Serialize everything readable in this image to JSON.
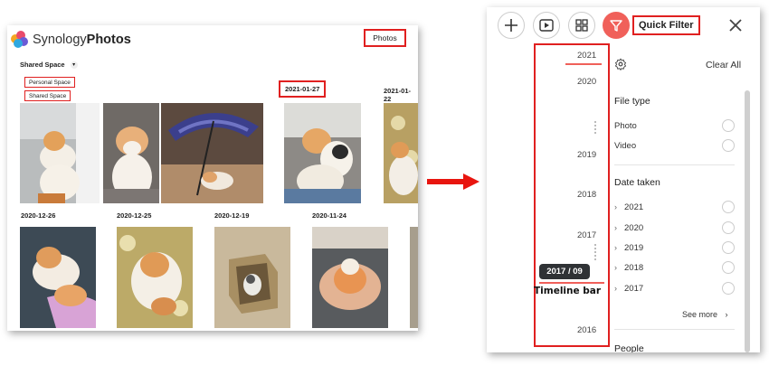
{
  "left": {
    "brand_light": "Synology",
    "brand_bold": "Photos",
    "photos_button": "Photos",
    "shared_space": "Shared Space",
    "space_menu": [
      "Personal Space",
      "Shared Space"
    ],
    "dates_row1": [
      "2021-01-27",
      "2021-01-22"
    ],
    "dates_row2": [
      "2020-12-26",
      "2020-12-25",
      "2020-12-19",
      "2020-11-24"
    ]
  },
  "right": {
    "quick_filter": "Quick Filter",
    "timeline": {
      "years": [
        "2021",
        "2020",
        "2019",
        "2018",
        "2017",
        "2016"
      ],
      "current": "2017 / 09",
      "caption": "Timeline bar"
    },
    "clear_all": "Clear All",
    "file_type": {
      "title": "File type",
      "options": [
        "Photo",
        "Video"
      ]
    },
    "date_taken": {
      "title": "Date taken",
      "options": [
        "2021",
        "2020",
        "2019",
        "2018",
        "2017"
      ],
      "see_more": "See more"
    },
    "people_title": "People"
  },
  "colors": {
    "accent": "#f0605a",
    "highlight_box": "#e02020",
    "arrow": "#e8150f"
  }
}
